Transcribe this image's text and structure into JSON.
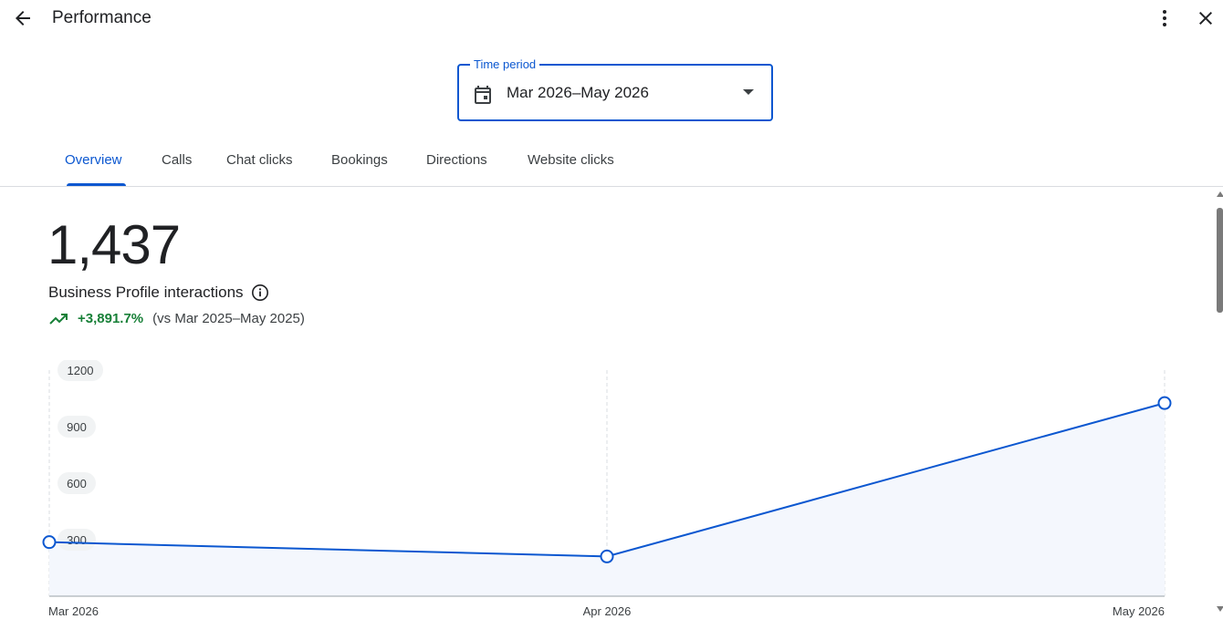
{
  "header": {
    "title": "Performance",
    "back_icon": "arrow-back-icon",
    "more_icon": "more-vert-icon",
    "close_icon": "close-icon"
  },
  "time_period": {
    "label": "Time period",
    "value": "Mar 2026–May 2026",
    "icon": "calendar-icon"
  },
  "tabs": [
    {
      "label": "Overview",
      "active": true
    },
    {
      "label": "Calls",
      "active": false
    },
    {
      "label": "Chat clicks",
      "active": false
    },
    {
      "label": "Bookings",
      "active": false
    },
    {
      "label": "Directions",
      "active": false
    },
    {
      "label": "Website clicks",
      "active": false
    }
  ],
  "summary": {
    "total": "1,437",
    "label": "Business Profile interactions",
    "change": "+3,891.7%",
    "comparison": "(vs Mar 2025–May 2025)"
  },
  "colors": {
    "accent": "#0b57d0",
    "positive": "#188038",
    "area_fill": "#f4f7fd"
  },
  "chart_data": {
    "type": "area",
    "categories": [
      "Mar 2026",
      "Apr 2026",
      "May 2026"
    ],
    "values": [
      287,
      211,
      1025
    ],
    "y_ticks": [
      "300",
      "600",
      "900",
      "1200"
    ],
    "ylim": [
      0,
      1200
    ],
    "grid": "vertical dashed"
  }
}
